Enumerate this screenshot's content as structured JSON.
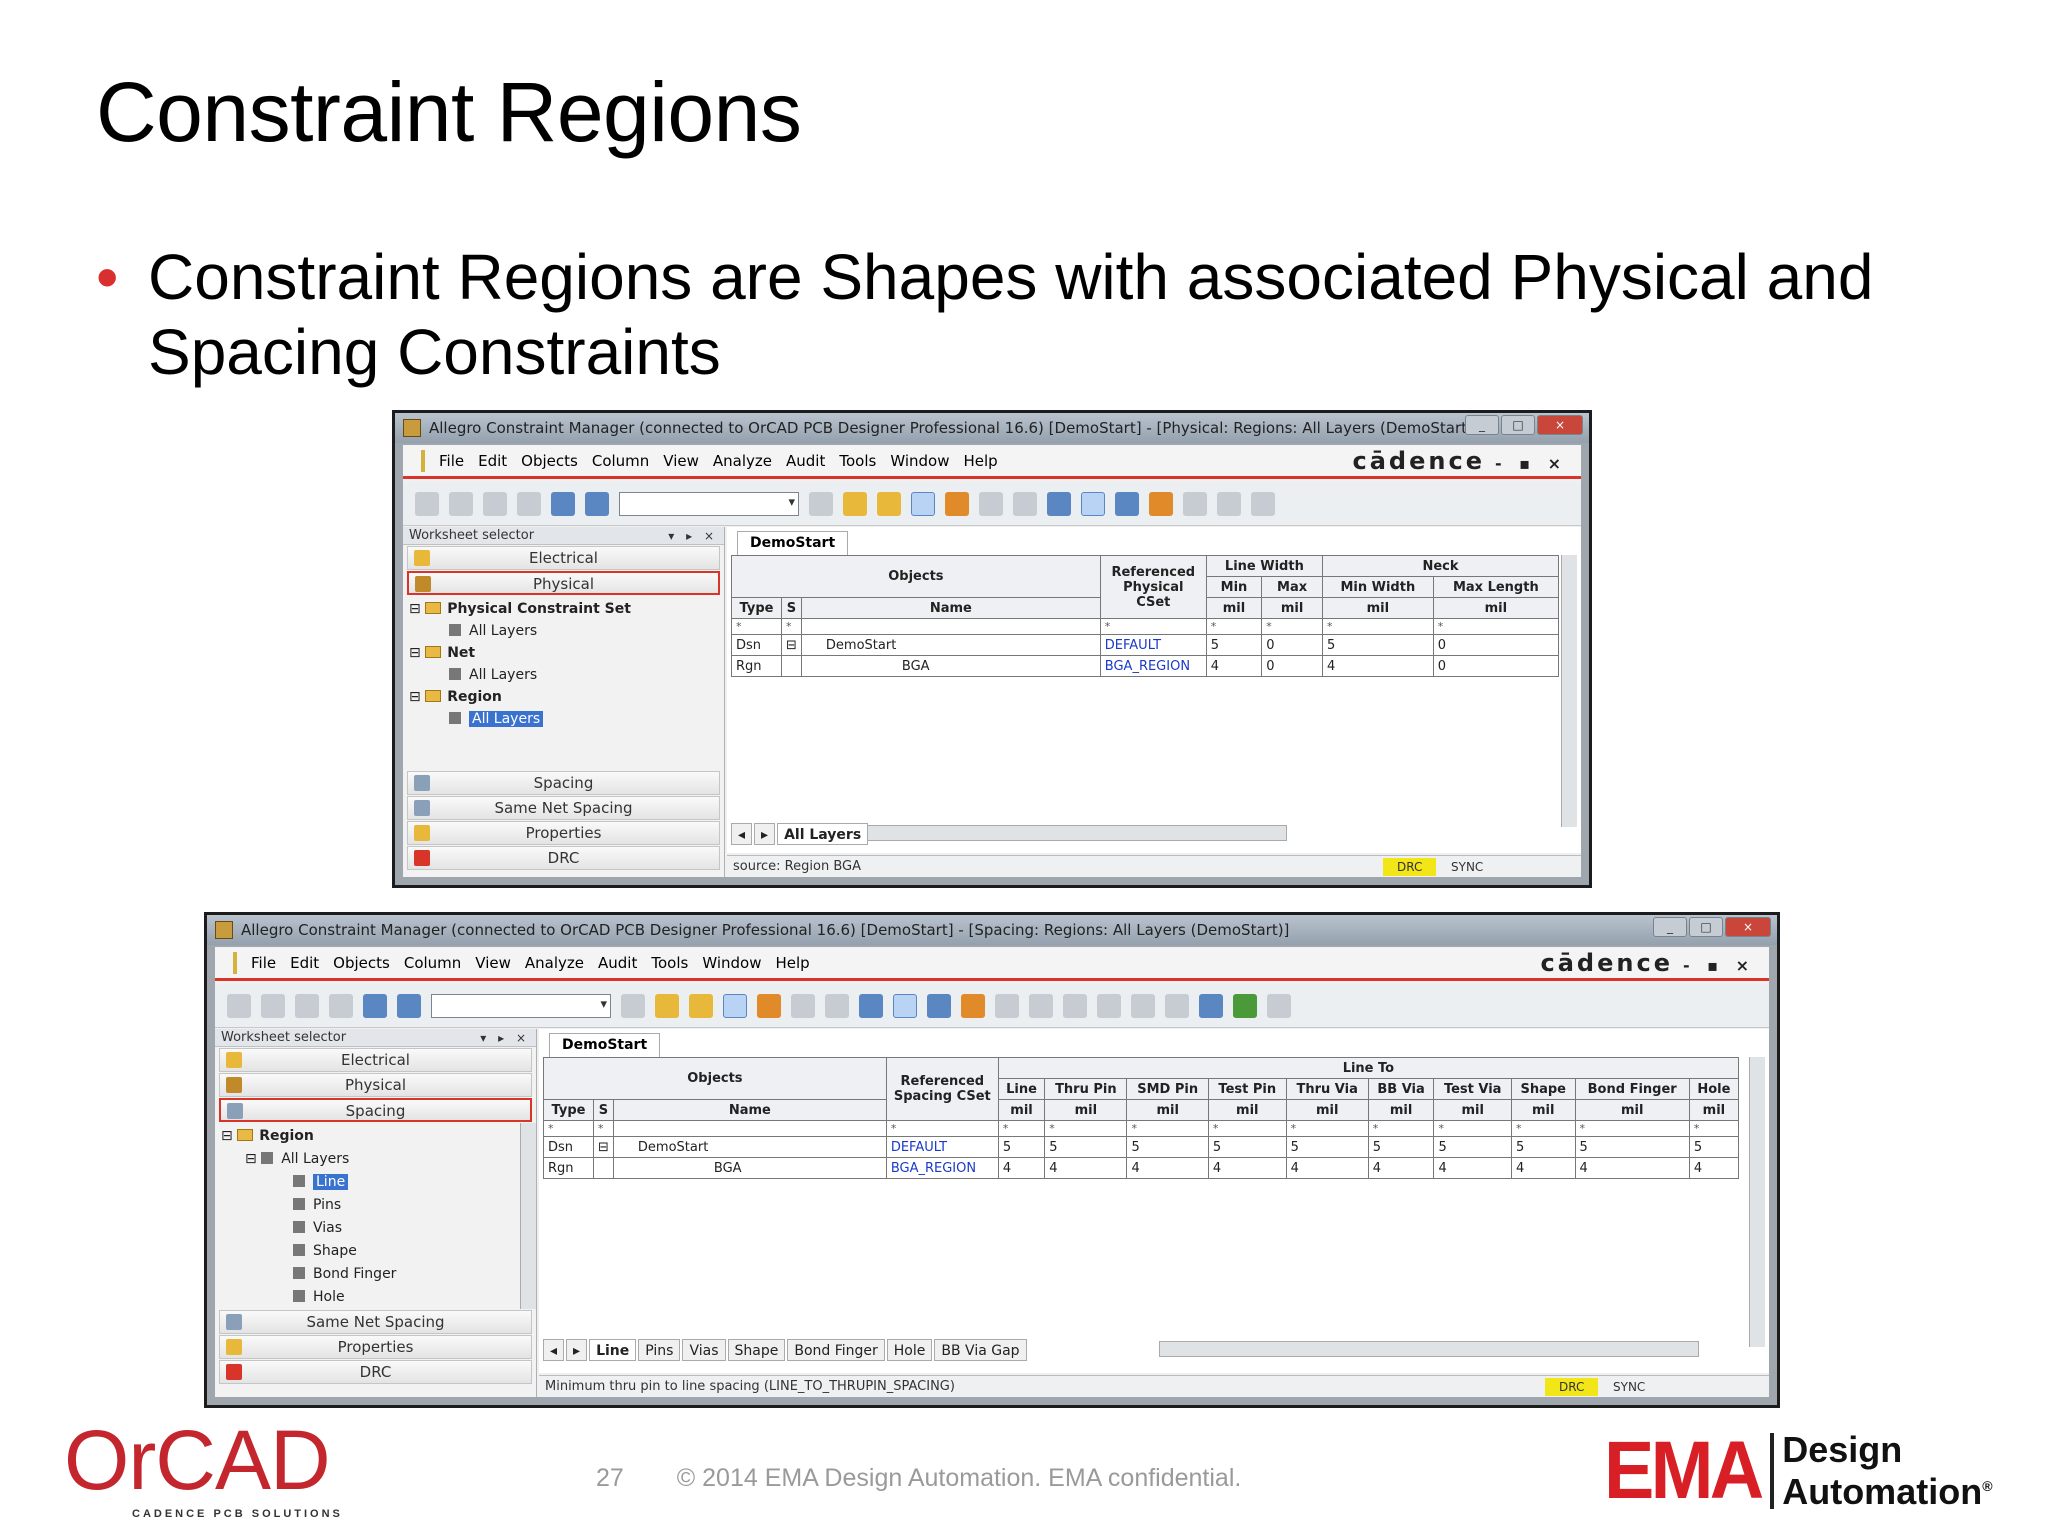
{
  "slide": {
    "title": "Constraint Regions",
    "bullet": "Constraint Regions are Shapes with associated Physical and Spacing Constraints",
    "bullet_glyph": "•",
    "page_number": "27",
    "copyright": "© 2014 EMA Design Automation. EMA confidential.",
    "orcad_logo": "OrCAD",
    "orcad_tagline": "CADENCE PCB SOLUTIONS",
    "ema_logo": "EMA",
    "ema_logo_line1": "Design",
    "ema_logo_line2": "Automation",
    "ema_mark": "®"
  },
  "menu": [
    "File",
    "Edit",
    "Objects",
    "Column",
    "View",
    "Analyze",
    "Audit",
    "Tools",
    "Window",
    "Help"
  ],
  "brand": "cādence",
  "brand_controls": "- ▪ ×",
  "win1": {
    "title": "Allegro Constraint Manager (connected to OrCAD PCB Designer Professional 16.6) [DemoStart] - [Physical: Regions: All Layers (DemoStart)]",
    "selector_title": "Worksheet selector",
    "selector_controls": "▾ ▸ ×",
    "top_buttons": [
      "Electrical",
      "Physical"
    ],
    "tree": [
      {
        "label": "Physical Constraint Set",
        "bold": true,
        "level": 0
      },
      {
        "label": "All Layers",
        "bold": false,
        "level": 1
      },
      {
        "label": "Net",
        "bold": true,
        "level": 0
      },
      {
        "label": "All Layers",
        "bold": false,
        "level": 1
      },
      {
        "label": "Region",
        "bold": true,
        "level": 0
      },
      {
        "label": "All Layers",
        "bold": false,
        "level": 1,
        "selected": true
      }
    ],
    "bottom_buttons": [
      "Spacing",
      "Same Net Spacing",
      "Properties",
      "DRC"
    ],
    "tab": "DemoStart",
    "headers": {
      "objects": "Objects",
      "ref": "Referenced Physical CSet",
      "line_width": "Line Width",
      "neck": "Neck",
      "min": "Min",
      "max": "Max",
      "min_width": "Min Width",
      "max_length": "Max Length",
      "type": "Type",
      "s": "S",
      "name": "Name",
      "unit": "mil"
    },
    "rows": [
      {
        "type": "Dsn",
        "s": "⊟",
        "name": "DemoStart",
        "ref": "DEFAULT",
        "vals": [
          "5",
          "0",
          "5",
          "0"
        ]
      },
      {
        "type": "Rgn",
        "s": "",
        "name": "BGA",
        "ref": "BGA_REGION",
        "vals": [
          "4",
          "0",
          "4",
          "0"
        ]
      }
    ],
    "sheet_tabs": [
      "All Layers"
    ],
    "status": "source: Region BGA",
    "drc": "DRC",
    "sync": "SYNC"
  },
  "win2": {
    "title": "Allegro Constraint Manager (connected to OrCAD PCB Designer Professional 16.6) [DemoStart] - [Spacing: Regions: All Layers (DemoStart)]",
    "selector_title": "Worksheet selector",
    "selector_controls": "▾ ▸ ×",
    "top_buttons": [
      "Electrical",
      "Physical",
      "Spacing"
    ],
    "tree": [
      {
        "label": "Region",
        "bold": true,
        "level": 0
      },
      {
        "label": "All Layers",
        "bold": false,
        "level": 1
      },
      {
        "label": "Line",
        "bold": false,
        "level": 2,
        "selected": true
      },
      {
        "label": "Pins",
        "bold": false,
        "level": 2
      },
      {
        "label": "Vias",
        "bold": false,
        "level": 2
      },
      {
        "label": "Shape",
        "bold": false,
        "level": 2
      },
      {
        "label": "Bond Finger",
        "bold": false,
        "level": 2
      },
      {
        "label": "Hole",
        "bold": false,
        "level": 2
      }
    ],
    "bottom_buttons": [
      "Same Net Spacing",
      "Properties",
      "DRC"
    ],
    "tab": "DemoStart",
    "headers": {
      "objects": "Objects",
      "ref": "Referenced Spacing CSet",
      "line_to": "Line To",
      "cols": [
        "Line",
        "Thru Pin",
        "SMD Pin",
        "Test Pin",
        "Thru Via",
        "BB Via",
        "Test Via",
        "Shape",
        "Bond Finger",
        "Hole"
      ],
      "type": "Type",
      "s": "S",
      "name": "Name",
      "unit": "mil"
    },
    "rows": [
      {
        "type": "Dsn",
        "s": "⊟",
        "name": "DemoStart",
        "ref": "DEFAULT",
        "vals": [
          "5",
          "5",
          "5",
          "5",
          "5",
          "5",
          "5",
          "5",
          "5",
          "5"
        ]
      },
      {
        "type": "Rgn",
        "s": "",
        "name": "BGA",
        "ref": "BGA_REGION",
        "vals": [
          "4",
          "4",
          "4",
          "4",
          "4",
          "4",
          "4",
          "4",
          "4",
          "4"
        ]
      }
    ],
    "sheet_tabs": [
      "Line",
      "Pins",
      "Vias",
      "Shape",
      "Bond Finger",
      "Hole",
      "BB Via Gap"
    ],
    "status": "Minimum thru pin to line spacing (LINE_TO_THRUPIN_SPACING)",
    "drc": "DRC",
    "sync": "SYNC"
  },
  "colors": {
    "accent_red": "#d8342a",
    "drc_yellow": "#f2e619",
    "link_blue": "#1b39c8",
    "orcad_red": "#c4262e",
    "ema_red": "#d81f26"
  }
}
